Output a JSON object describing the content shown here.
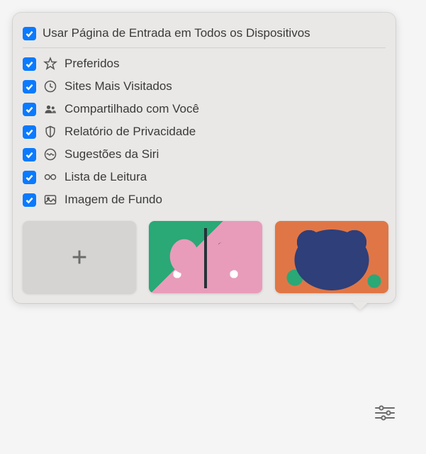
{
  "header": {
    "label": "Usar Página de Entrada em Todos os Dispositivos",
    "checked": true
  },
  "options": [
    {
      "id": "favorites",
      "label": "Preferidos",
      "checked": true,
      "icon": "star"
    },
    {
      "id": "frequently-visited",
      "label": "Sites Mais Visitados",
      "checked": true,
      "icon": "clock"
    },
    {
      "id": "shared-with-you",
      "label": "Compartilhado com Você",
      "checked": true,
      "icon": "people"
    },
    {
      "id": "privacy-report",
      "label": "Relatório de Privacidade",
      "checked": true,
      "icon": "shield"
    },
    {
      "id": "siri-suggestions",
      "label": "Sugestões da Siri",
      "checked": true,
      "icon": "siri"
    },
    {
      "id": "reading-list",
      "label": "Lista de Leitura",
      "checked": true,
      "icon": "glasses"
    },
    {
      "id": "background-image",
      "label": "Imagem de Fundo",
      "checked": true,
      "icon": "picture"
    }
  ],
  "thumbnails": [
    {
      "type": "add",
      "label": "+"
    },
    {
      "type": "butterfly"
    },
    {
      "type": "bear"
    }
  ]
}
